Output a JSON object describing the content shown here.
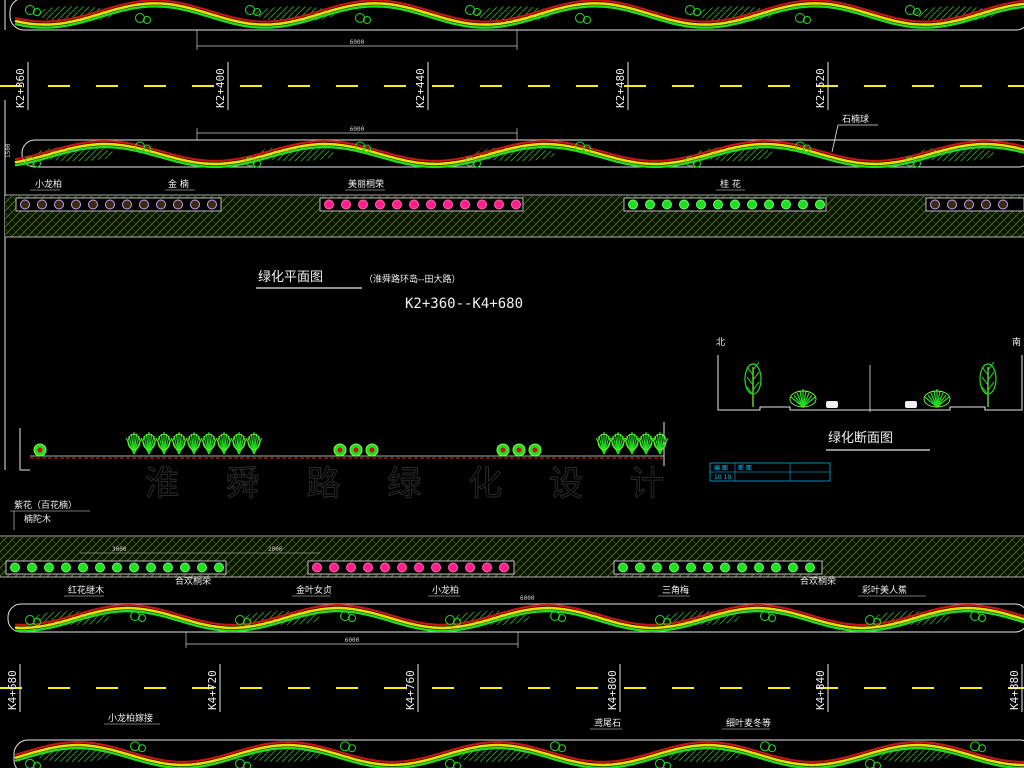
{
  "colors": {
    "background": "#000000",
    "road_centerline": "#ffee00",
    "stroke_white": "#e6e6e6",
    "shrub_green": "#22dd22",
    "band_yellow": "#e8e000",
    "band_red": "#c81414",
    "flower_magenta": "#ff1e8c",
    "hatch_olive": "#3c5a14",
    "table_cyan": "#00c8ff"
  },
  "stations_top": [
    "K2+360",
    "K2+400",
    "K2+440",
    "K2+480",
    "K2+520"
  ],
  "stations_bottom": [
    "K4+680",
    "K4+720",
    "K4+760",
    "K4+800",
    "K4+840",
    "K4+880"
  ],
  "top_labels": {
    "ref_label": "石楠球",
    "strip_a": "小龙柏",
    "strip_b": "金 楠",
    "strip_c": "美丽桐荣",
    "strip_d": "桂 花"
  },
  "plan_title": {
    "main": "绿化平面图",
    "route": "（淮舜路环岛--田大路）",
    "range": "K2+360--K4+680"
  },
  "section_title": "绿化断面图",
  "section_labels": {
    "left": "北",
    "right": "南"
  },
  "section_table": {
    "header": "编 图",
    "r1": "断 面",
    "r2": "10 10"
  },
  "left_notes": {
    "n1": "紫花（百花楠）",
    "n2": "楠陀木"
  },
  "bottom_labels": {
    "b1": "红花继木",
    "b2": "金叶女贞",
    "b3": "小龙柏",
    "b4": "三角梅",
    "b5": "彩叶美人蕉",
    "b6": "合欢桐荣",
    "b7": "合欢桐荣",
    "c1": "小龙柏嫁接",
    "c2": "鸢尾石",
    "c3": "细叶麦冬等"
  },
  "dimensions": {
    "d1": "6000",
    "d2": "6000",
    "d3": "6000",
    "d4": "3000",
    "d5": "6000",
    "d6": "2000",
    "d7": "1500"
  },
  "faded_caption": "淮 舜 路 绿 化 设 计"
}
